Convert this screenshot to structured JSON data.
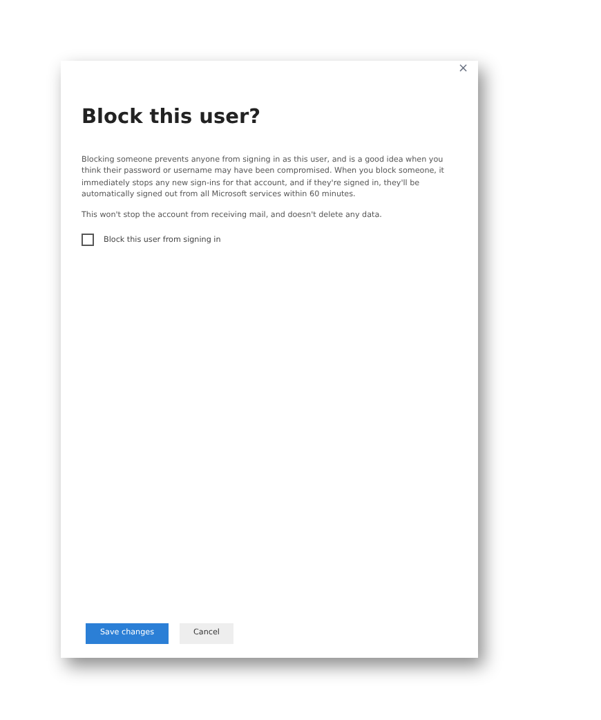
{
  "dialog": {
    "close": "×",
    "title": "Block this user?",
    "paragraphs": [
      "Blocking someone prevents anyone from signing in as this user, and is a good idea when you think their password or username may have been compromised. When you block someone, it immediately stops any new sign-ins for that account, and if they're signed in, they'll be automatically signed out from all Microsoft services within 60 minutes.",
      "This won't stop the account from receiving mail, and doesn't delete any data."
    ],
    "checkbox": {
      "label": "Block this user from signing in",
      "checked": false
    },
    "buttons": [
      {
        "label": "Save changes",
        "kind": "primary"
      },
      {
        "label": "Cancel",
        "kind": "secondary"
      }
    ]
  }
}
